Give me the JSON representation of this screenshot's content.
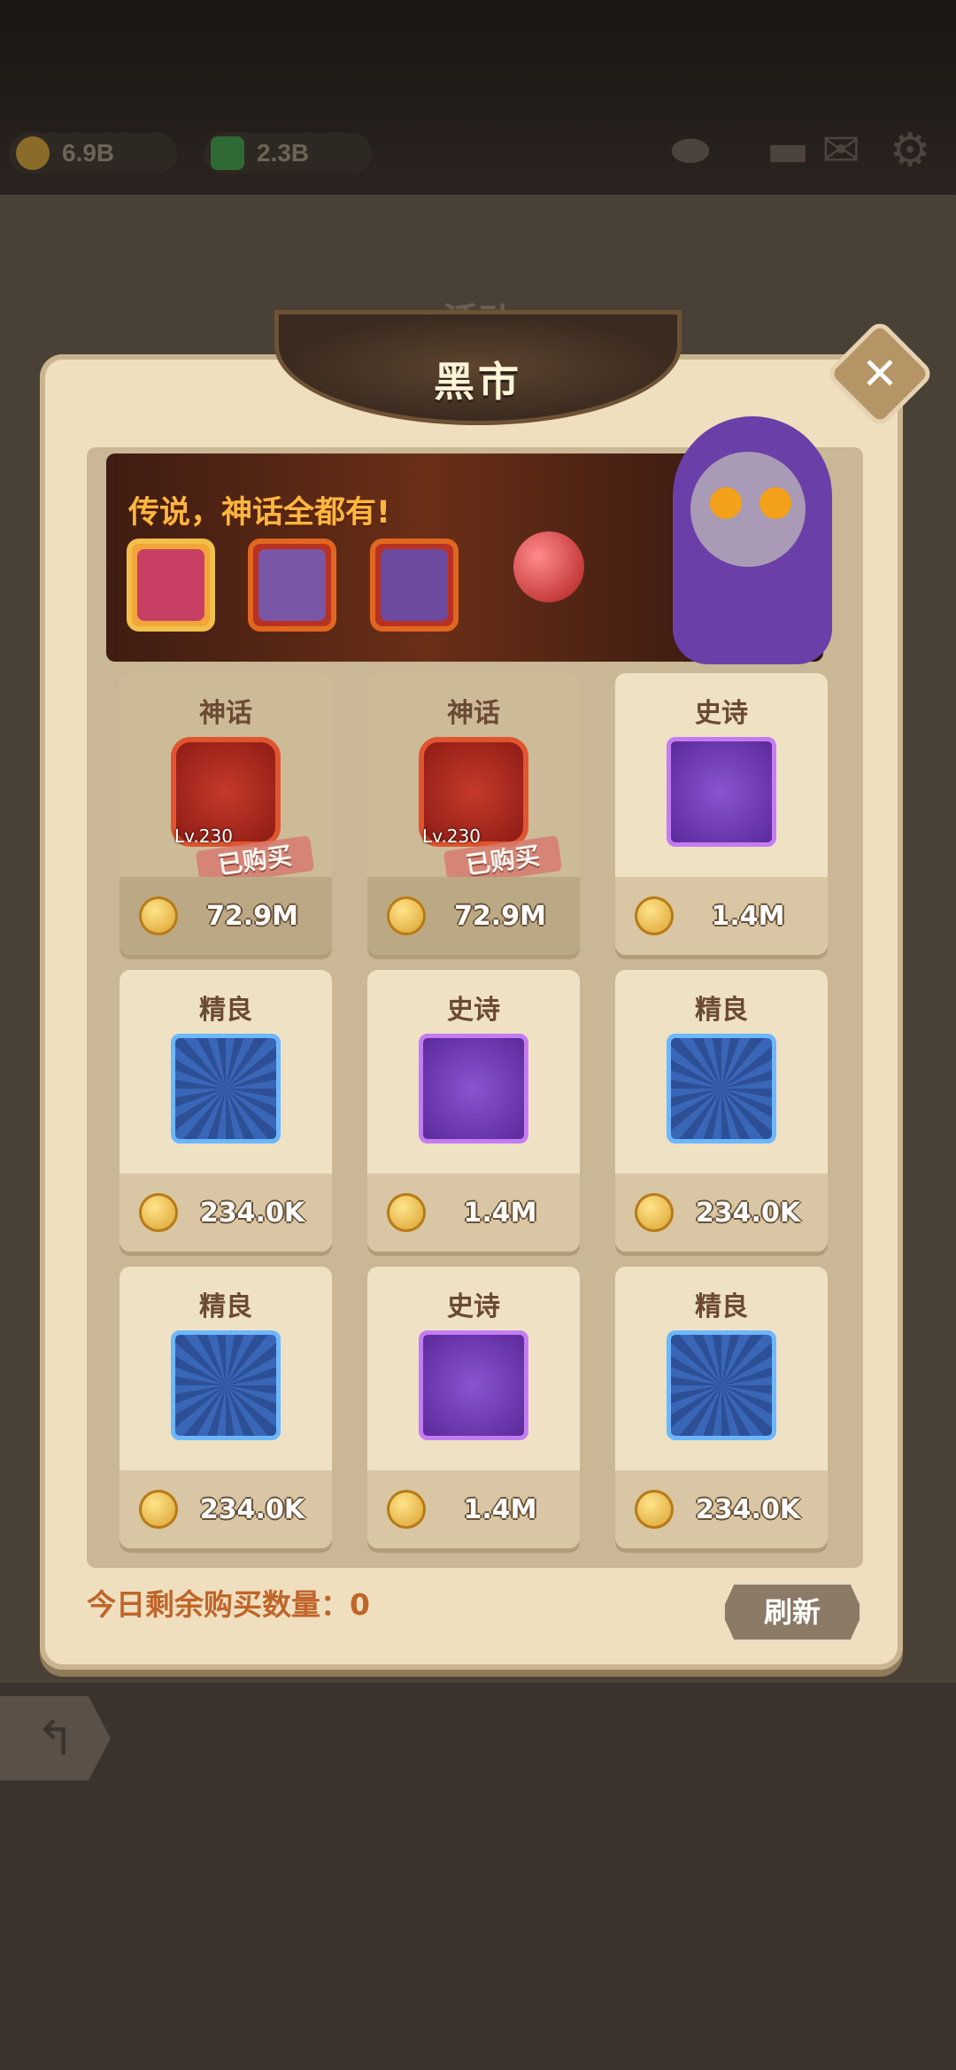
{
  "currency": {
    "gold": "6.9B",
    "gems": "2.3B"
  },
  "background_title": "活动",
  "window_title": "黑市",
  "banner": {
    "headline": "传说，神话全都有!"
  },
  "cards": [
    {
      "rarity": "神话",
      "tier": "mythic",
      "level": "Lv.230",
      "status": "已购买",
      "price": "72.9M",
      "item_icon": "spear-icon"
    },
    {
      "rarity": "神话",
      "tier": "mythic",
      "level": "Lv.230",
      "status": "已购买",
      "price": "72.9M",
      "item_icon": "boots-icon"
    },
    {
      "rarity": "史诗",
      "tier": "epic",
      "price": "1.4M",
      "item_icon": "gauntlet-icon"
    },
    {
      "rarity": "精良",
      "tier": "fine",
      "price": "234.0K",
      "item_icon": "cloak-icon"
    },
    {
      "rarity": "史诗",
      "tier": "epic",
      "price": "1.4M",
      "item_icon": "helmet-icon"
    },
    {
      "rarity": "精良",
      "tier": "fine",
      "price": "234.0K",
      "item_icon": "glove-icon"
    },
    {
      "rarity": "精良",
      "tier": "fine",
      "price": "234.0K",
      "item_icon": "sandal-icon"
    },
    {
      "rarity": "史诗",
      "tier": "epic",
      "price": "1.4M",
      "item_icon": "staff-icon"
    },
    {
      "rarity": "精良",
      "tier": "fine",
      "price": "234.0K",
      "item_icon": "armor-icon"
    }
  ],
  "footer": {
    "remaining_purchases": "今日剩余购买数量：0",
    "refresh_label": "刷新"
  },
  "colors": {
    "mythic": "#c6392b",
    "epic": "#8a54d0",
    "fine": "#3a66b8",
    "panel": "#f0dfbf"
  }
}
